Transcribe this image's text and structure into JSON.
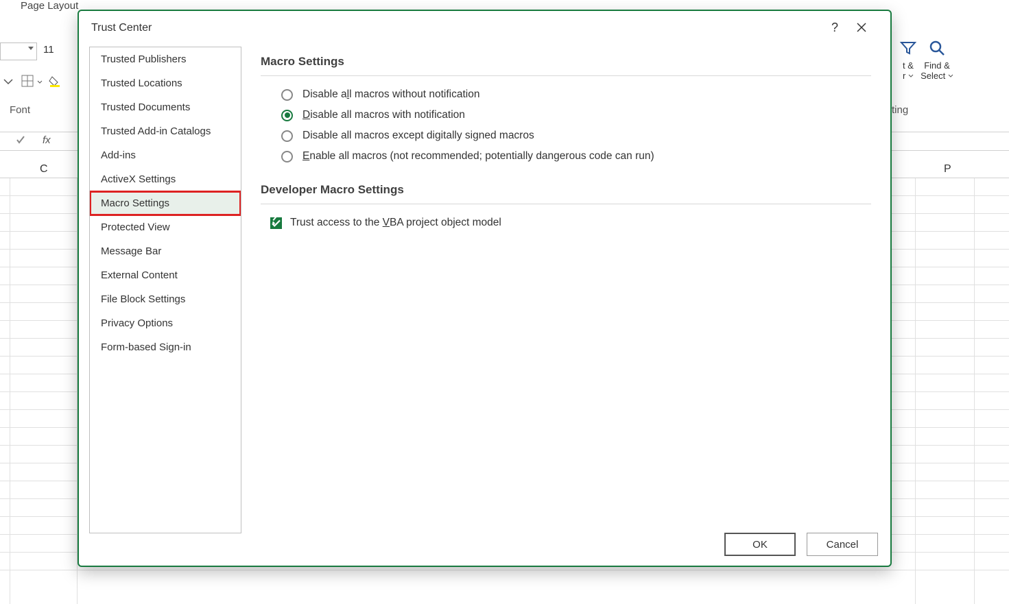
{
  "ribbon": {
    "tab_page_layout": "Page Layout",
    "font_size": "11",
    "group_label_font": "Font",
    "fx_label": "fx",
    "column_c": "C",
    "column_p": "P",
    "right_truncated_1a": "t &",
    "right_truncated_1b": "r",
    "find_select_1": "Find &",
    "find_select_2": "Select",
    "right_truncated_group": "ting"
  },
  "dialog": {
    "title": "Trust Center",
    "help": "?",
    "sidebar": [
      "Trusted Publishers",
      "Trusted Locations",
      "Trusted Documents",
      "Trusted Add-in Catalogs",
      "Add-ins",
      "ActiveX Settings",
      "Macro Settings",
      "Protected View",
      "Message Bar",
      "External Content",
      "File Block Settings",
      "Privacy Options",
      "Form-based Sign-in"
    ],
    "selected_index": 6,
    "section_macro": "Macro Settings",
    "radios": {
      "r1_pre": "Disable a",
      "r1_u": "l",
      "r1_post": "l macros without notification",
      "r2_u": "D",
      "r2_post": "isable all macros with notification",
      "r3_pre": "Disable all macros except di",
      "r3_u": "g",
      "r3_post": "itally signed macros",
      "r4_u": "E",
      "r4_post": "nable all macros (not recommended; potentially dangerous code can run)",
      "selected": 1
    },
    "section_dev": "Developer Macro Settings",
    "checkbox_pre": "Trust access to the ",
    "checkbox_u": "V",
    "checkbox_post": "BA project object model",
    "checkbox_checked": true,
    "ok": "OK",
    "cancel": "Cancel"
  }
}
